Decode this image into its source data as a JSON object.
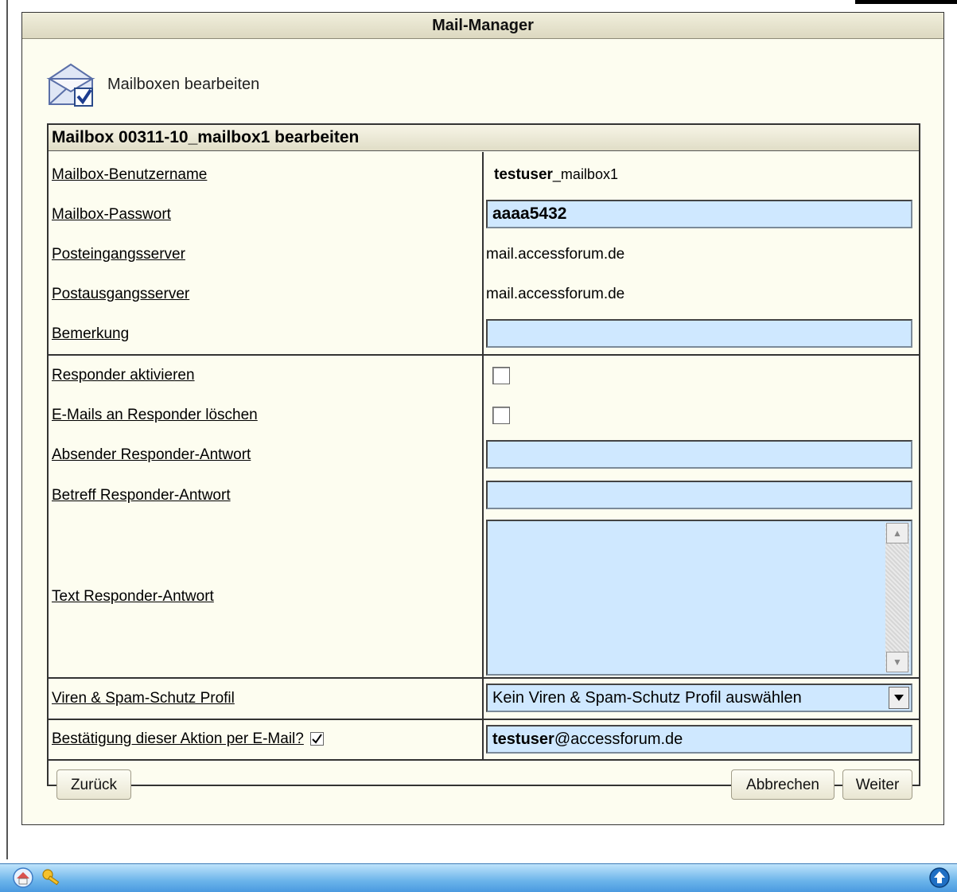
{
  "app": {
    "panel_title": "Mail-Manager",
    "section_title": "Mailboxen bearbeiten"
  },
  "form": {
    "title": "Mailbox 00311-10_mailbox1 bearbeiten",
    "rows": {
      "username_label": "Mailbox-Benutzername",
      "username_prefix": "testuser",
      "username_suffix": "_mailbox1",
      "password_label": "Mailbox-Passwort",
      "password_value": "aaaa5432",
      "incoming_label": "Posteingangsserver",
      "incoming_value": "mail.accessforum.de",
      "outgoing_label": "Postausgangsserver",
      "outgoing_value": "mail.accessforum.de",
      "remark_label": "Bemerkung",
      "remark_value": "",
      "responder_activate_label": "Responder aktivieren",
      "responder_activate_checked": false,
      "responder_delete_label": "E-Mails an Responder löschen",
      "responder_delete_checked": false,
      "responder_sender_label": "Absender Responder-Antwort",
      "responder_sender_value": "",
      "responder_subject_label": "Betreff Responder-Antwort",
      "responder_subject_value": "",
      "responder_text_label": "Text Responder-Antwort",
      "responder_text_value": "",
      "spam_label": "Viren & Spam-Schutz Profil",
      "spam_selected": "Kein Viren & Spam-Schutz Profil auswählen",
      "confirm_label": "Bestätigung dieser Aktion per E-Mail?",
      "confirm_checked": true,
      "confirm_email_user": "testuser",
      "confirm_email_domain": "@accessforum.de"
    },
    "buttons": {
      "back": "Zurück",
      "cancel": "Abbrechen",
      "next": "Weiter"
    }
  },
  "taskbar": {
    "icons": [
      "home-icon",
      "key-icon",
      "scroll-up-icon"
    ]
  },
  "colors": {
    "panel_bg": "#fdfdf0",
    "input_bg": "#cfe8ff",
    "taskbar": "#6bb4ea"
  }
}
